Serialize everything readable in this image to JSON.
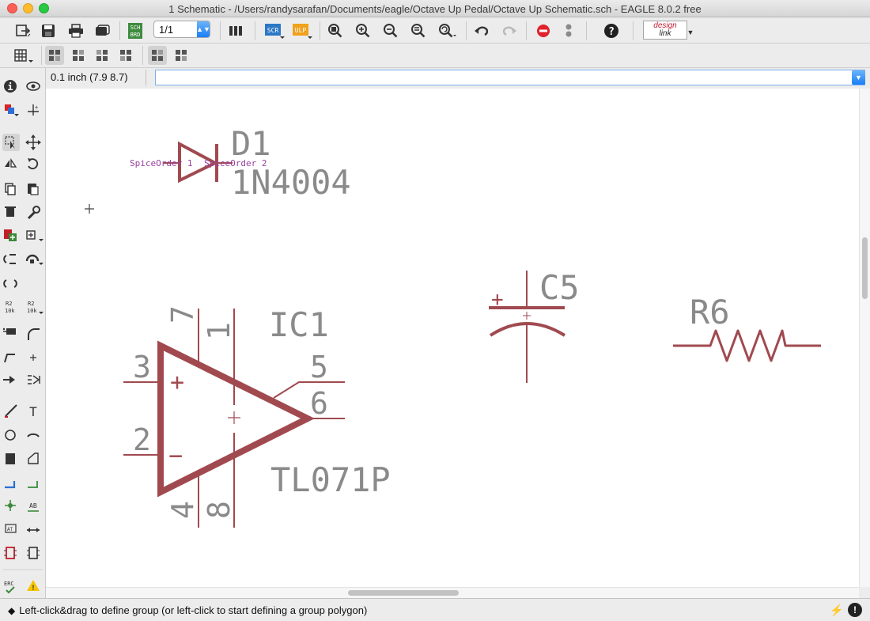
{
  "window": {
    "title": "1 Schematic - /Users/randysarafan/Documents/eagle/Octave Up Pedal/Octave Up Schematic.sch - EAGLE 8.0.2 free"
  },
  "toolbar": {
    "sheet_value": "1/1",
    "sch_brd_label": "SCH BRD",
    "scr_label": "SCR",
    "ulp_label": "ULP",
    "designlink_line1": "design",
    "designlink_line2": "link",
    "icons": [
      "open-icon",
      "save-icon",
      "print-icon",
      "cam-icon",
      "sch-brd-switch-icon",
      "sheet-select",
      "library-icon",
      "script-icon",
      "ulp-icon",
      "zoom-fit-icon",
      "zoom-in-icon",
      "zoom-out-icon",
      "zoom-select-icon",
      "zoom-redraw-icon",
      "undo-icon",
      "redo-icon",
      "stop-icon",
      "go-icon",
      "help-icon",
      "designlink-icon"
    ]
  },
  "command": {
    "coordinate": "0.1 inch (7.9 8.7)",
    "input_value": ""
  },
  "schematic": {
    "diode": {
      "name": "D1",
      "value": "1N4004",
      "spice_left": "SpiceOrder 1",
      "spice_right": "SpiceOrder 2"
    },
    "opamp": {
      "name": "IC1",
      "value": "TL071P",
      "pins": [
        "3",
        "2",
        "7",
        "1",
        "5",
        "6",
        "4",
        "8"
      ],
      "plus": "+",
      "minus": "−"
    },
    "capacitor": {
      "name": "C5",
      "plus": "+"
    },
    "resistor": {
      "name": "R6"
    }
  },
  "status": {
    "message": "Left-click&drag to define group (or left-click to start defining a group polygon)",
    "diamond": "◆",
    "alert": "!"
  },
  "colors": {
    "net": "#a04a50",
    "text": "#8a8a8a",
    "spice": "#9a3ea0",
    "accent": "#1a7ef5"
  }
}
